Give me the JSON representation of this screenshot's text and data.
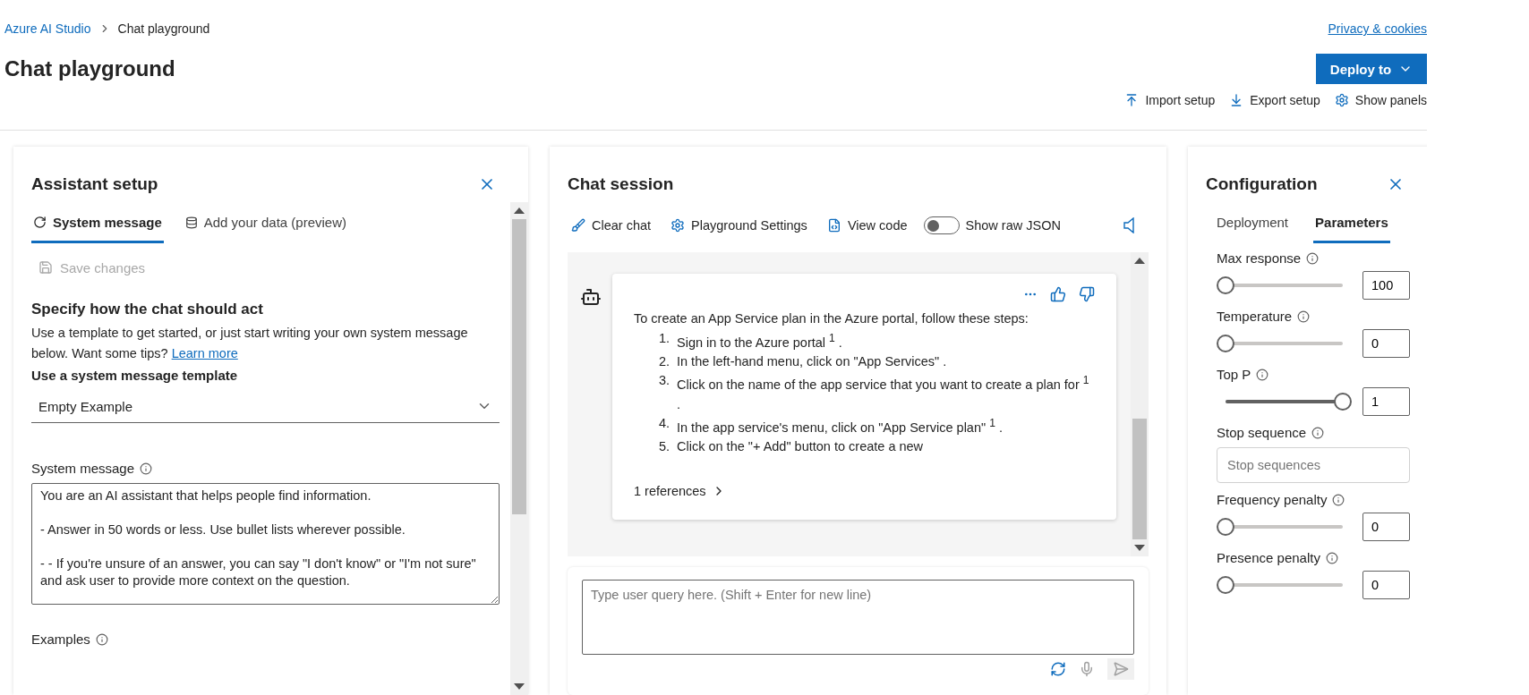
{
  "breadcrumb": {
    "parent": "Azure AI Studio",
    "current": "Chat playground"
  },
  "privacy_link": "Privacy & cookies",
  "title": "Chat playground",
  "deploy_button": "Deploy to",
  "actions": [
    {
      "kind": "import",
      "label": "Import setup"
    },
    {
      "kind": "export",
      "label": "Export setup"
    },
    {
      "kind": "panels",
      "label": "Show panels"
    }
  ],
  "assistant_setup": {
    "title": "Assistant setup",
    "tabs": [
      {
        "kind": "system",
        "label": "System message",
        "selected": true
      },
      {
        "kind": "data",
        "label": "Add your data (preview)",
        "selected": false
      }
    ],
    "save_button": {
      "label": "Save changes",
      "disabled": true
    },
    "heading": "Specify how the chat should act",
    "description": "Use a template to get started, or just start writing your own system message below. Want some tips?",
    "learn_more": "Learn more",
    "template_label": "Use a system message template",
    "template_value": "Empty Example",
    "system_message_label": "System message",
    "system_message": "You are an AI assistant that helps people find information.\n\n- Answer in 50 words or less. Use bullet lists wherever possible.\n\n- - If you're unsure of an answer, you can say \"I don't know\" or \"I'm not sure\" and ask user to provide more context on the question.",
    "examples_label": "Examples"
  },
  "chat_session": {
    "title": "Chat session",
    "toolbar": [
      {
        "kind": "clear",
        "label": "Clear chat"
      },
      {
        "kind": "settings",
        "label": "Playground Settings"
      },
      {
        "kind": "code",
        "label": "View code"
      }
    ],
    "raw_json_toggle": {
      "label": "Show raw JSON",
      "on": false
    },
    "message": {
      "intro": "To create an App Service plan in the Azure portal, follow these steps:",
      "steps": [
        {
          "number": "1.",
          "text": "Sign in to the Azure portal $^{1}$ ."
        },
        {
          "number": "2.",
          "text": "In the left-hand menu, click on \"App Services\" ."
        },
        {
          "number": "3.",
          "text": "Click on the name of the app service that you want to create a plan for $^{1}$ ."
        },
        {
          "number": "4.",
          "text": "In the app service's menu, click on \"App Service plan\" $^{1}$ ."
        },
        {
          "number": "5.",
          "text": "Click on the \"+ Add\" button to create a new"
        }
      ],
      "references": "1 references"
    },
    "input_placeholder": "Type user query here. (Shift + Enter for new line)"
  },
  "configuration": {
    "title": "Configuration",
    "tabs": [
      {
        "label": "Deployment",
        "selected": false
      },
      {
        "label": "Parameters",
        "selected": true
      }
    ],
    "params": [
      {
        "kind": "slider",
        "label": "Max response",
        "level": 0,
        "value": "100"
      },
      {
        "kind": "slider",
        "label": "Temperature",
        "level": 0,
        "value": "0"
      },
      {
        "kind": "slider",
        "label": "Top P",
        "level": 1,
        "value": "1"
      },
      {
        "kind": "text",
        "label": "Stop sequence",
        "placeholder": "Stop sequences"
      },
      {
        "kind": "slider",
        "label": "Frequency penalty",
        "level": 0,
        "value": "0"
      },
      {
        "kind": "slider",
        "label": "Presence penalty",
        "level": 0,
        "value": "0"
      }
    ]
  }
}
